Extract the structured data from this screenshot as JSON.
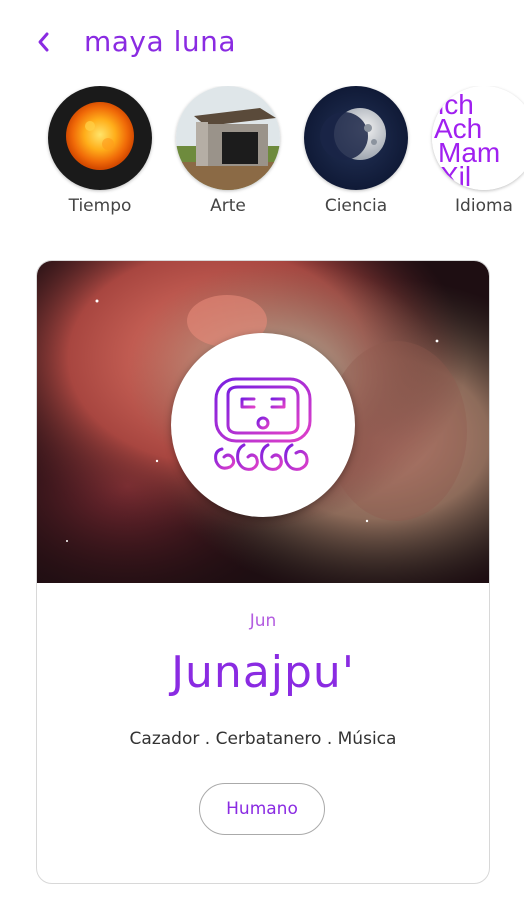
{
  "header": {
    "back_icon": "chevron-left-icon",
    "title": "maya luna"
  },
  "categories": [
    {
      "label": "Tiempo",
      "icon": "sun-image"
    },
    {
      "label": "Arte",
      "icon": "stone-house-image"
    },
    {
      "label": "Ciencia",
      "icon": "moon-image"
    },
    {
      "label": "Idioma",
      "icon": "script-letters-image"
    }
  ],
  "card": {
    "glyph_icon": "maya-day-glyph-icon",
    "short_name": "Jun",
    "name": "Junajpu'",
    "attributes": "Cazador . Cerbatanero . Música",
    "tag": "Humano"
  },
  "colors": {
    "accent": "#8a2be2",
    "accent_light": "#b35ce0",
    "pink": "#e040c8"
  }
}
